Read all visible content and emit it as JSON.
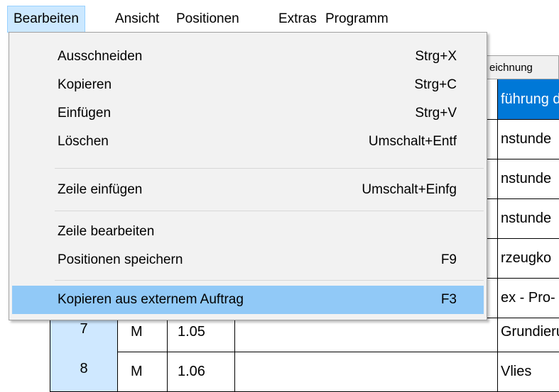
{
  "menubar": {
    "items": [
      {
        "label": "Bearbeiten",
        "active": true
      },
      {
        "label": "Ansicht"
      },
      {
        "label": "Positionen"
      },
      {
        "label": "Extras"
      },
      {
        "label": "Programm"
      }
    ]
  },
  "grid": {
    "header_label": "eichnung",
    "rows": [
      {
        "num": "",
        "type": "",
        "pos": "",
        "text": "führung d",
        "selected": true
      },
      {
        "num": "",
        "type": "",
        "pos": "",
        "text": "nstunde"
      },
      {
        "num": "",
        "type": "",
        "pos": "",
        "text": "nstunde"
      },
      {
        "num": "",
        "type": "",
        "pos": "",
        "text": "nstunde"
      },
      {
        "num": "",
        "type": "",
        "pos": "",
        "text": "rzeugko"
      },
      {
        "num": "",
        "type": "",
        "pos": "",
        "text": "ex - Pro-"
      },
      {
        "num": "7",
        "type": "M",
        "pos": "1.05",
        "text": "Grundierung"
      },
      {
        "num": "8",
        "type": "M",
        "pos": "1.06",
        "text": "Vlies"
      }
    ]
  },
  "dropdown": {
    "items": [
      {
        "label": "Ausschneiden",
        "shortcut": "Strg+X"
      },
      {
        "label": "Kopieren",
        "shortcut": "Strg+C"
      },
      {
        "label": "Einfügen",
        "shortcut": "Strg+V"
      },
      {
        "label": "Löschen",
        "shortcut": "Umschalt+Entf"
      },
      {
        "label": "Zeile einfügen",
        "shortcut": "Umschalt+Einfg"
      },
      {
        "label": "Zeile bearbeiten",
        "shortcut": ""
      },
      {
        "label": "Positionen speichern",
        "shortcut": "F9"
      },
      {
        "label": "Kopieren aus externem Auftrag",
        "shortcut": "F3",
        "highlighted": true
      }
    ]
  },
  "colors": {
    "menu_active_bg": "#cce8ff",
    "menu_highlight_bg": "#91c9f7",
    "selection_bg": "#0078d7",
    "row_number_bg": "#cfe8ff"
  }
}
